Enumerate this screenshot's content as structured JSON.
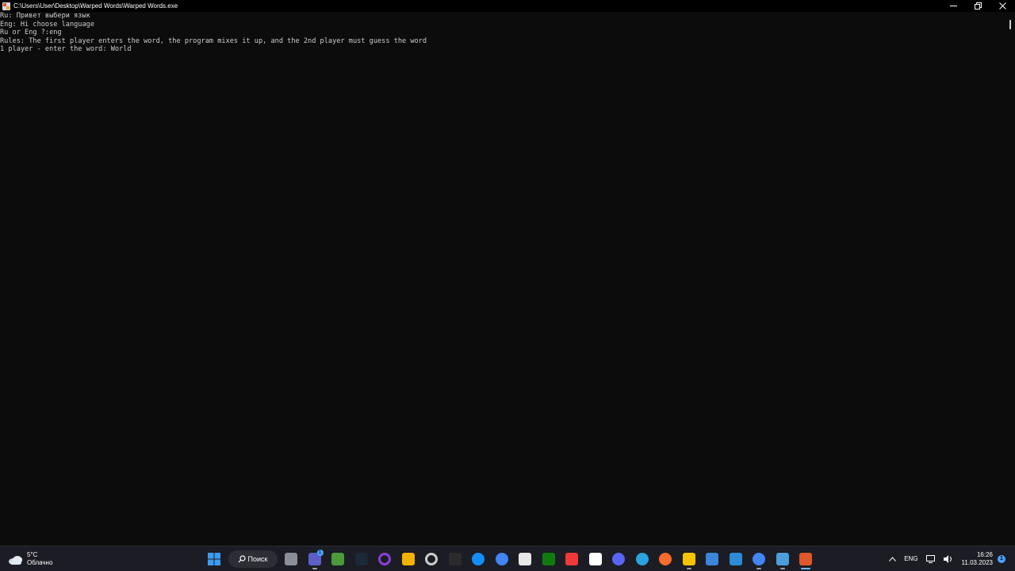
{
  "window": {
    "title": "C:\\Users\\User\\Desktop\\Warped Words\\Warped Words.exe",
    "minimize_label": "—",
    "maximize_label": "❐",
    "close_label": "✕"
  },
  "console": {
    "lines": [
      "Ru: Привет выбери язык",
      "Eng: Hi choose language",
      "Ru or Eng ?:eng",
      "Rules: The first player enters the word, the program mixes it up, and the 2nd player must guess the word",
      "1 player - enter the word: World"
    ]
  },
  "taskbar": {
    "weather_temp": "5°C",
    "weather_desc": "Облачно",
    "search_label": "Поиск",
    "apps": [
      {
        "name": "task-view",
        "color": "#8a8f99"
      },
      {
        "name": "teams",
        "color": "#5b5fc7",
        "badge": "1"
      },
      {
        "name": "minecraft",
        "color": "#4c9a3c"
      },
      {
        "name": "steam",
        "color": "#1b2838"
      },
      {
        "name": "cortana-ring",
        "color": "#8b3fd9"
      },
      {
        "name": "rockstar",
        "color": "#f3b200"
      },
      {
        "name": "gog-ring",
        "color": "#cccccc"
      },
      {
        "name": "epic-games",
        "color": "#2b2b2b"
      },
      {
        "name": "battle-net",
        "color": "#148eff"
      },
      {
        "name": "chrome",
        "color": "#4285f4"
      },
      {
        "name": "microsoft-store",
        "color": "#e8e8e8"
      },
      {
        "name": "xbox",
        "color": "#107c10"
      },
      {
        "name": "vivaldi",
        "color": "#ef3939"
      },
      {
        "name": "capcut",
        "color": "#ffffff"
      },
      {
        "name": "discord",
        "color": "#5865f2"
      },
      {
        "name": "telegram",
        "color": "#2aa3e0"
      },
      {
        "name": "origin",
        "color": "#f56c2d"
      },
      {
        "name": "file-explorer",
        "color": "#f5c400"
      },
      {
        "name": "control-panel",
        "color": "#3a86d8"
      },
      {
        "name": "photos",
        "color": "#2e8bd6"
      },
      {
        "name": "chrome-2",
        "color": "#4285f4"
      },
      {
        "name": "notepad",
        "color": "#4b9ddb"
      },
      {
        "name": "warped-words-app",
        "color": "#e0572a"
      }
    ],
    "tray_lang": "ENG",
    "time": "16:26",
    "date": "11.03.2023",
    "notif_count": "1"
  }
}
